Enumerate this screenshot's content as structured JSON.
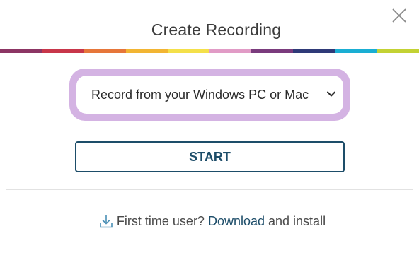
{
  "dialog": {
    "title": "Create Recording",
    "close_icon": "close-icon"
  },
  "stripe_colors": [
    "#8c3564",
    "#c8364a",
    "#e6763a",
    "#f2b533",
    "#f4e04a",
    "#e19bc6",
    "#7a3b7d",
    "#2f3a78",
    "#1aaed3",
    "#c3d234"
  ],
  "recording_source": {
    "selected": "Record from your Windows PC or Mac",
    "chevron_icon": "chevron-down-icon",
    "ring_color": "#d4b3e3"
  },
  "start_button": {
    "label": "START",
    "color": "#1d4d69"
  },
  "footer": {
    "icon": "download-icon",
    "prefix": "First time user?",
    "link": "Download",
    "suffix": "and install"
  }
}
